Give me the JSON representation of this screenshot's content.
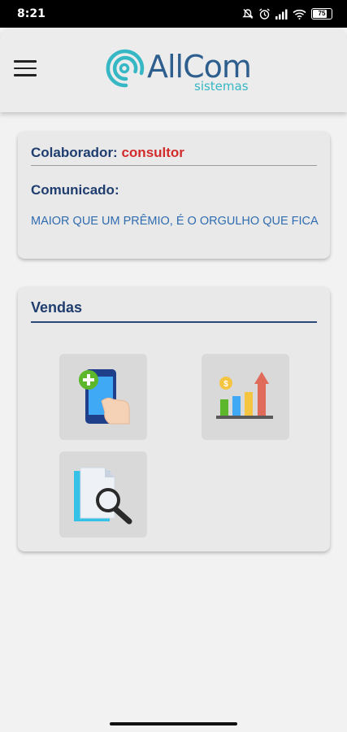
{
  "status_bar": {
    "time": "8:21",
    "battery_percent": 75,
    "battery_label": "75",
    "icons": [
      "mute-icon",
      "alarm-icon",
      "signal-icon",
      "wifi-icon",
      "battery-icon"
    ]
  },
  "header": {
    "logo_name": "AllCom",
    "logo_subtitle": "sistemas",
    "menu_icon": "hamburger-menu-icon"
  },
  "info_card": {
    "colaborador_label": "Colaborador:",
    "colaborador_value": "consultor",
    "comunicado_label": "Comunicado:",
    "comunicado_text": "MAIOR QUE UM PRÊMIO, É O ORGULHO QUE FICA"
  },
  "sales_card": {
    "title": "Vendas",
    "tiles": [
      {
        "icon": "new-sale-phone-icon"
      },
      {
        "icon": "sales-chart-icon"
      },
      {
        "icon": "search-document-icon"
      }
    ]
  },
  "colors": {
    "primary_dark": "#1f3d6e",
    "accent_red": "#d32b2b",
    "link_blue": "#2f6cb0",
    "logo_teal": "#36b7c4"
  }
}
